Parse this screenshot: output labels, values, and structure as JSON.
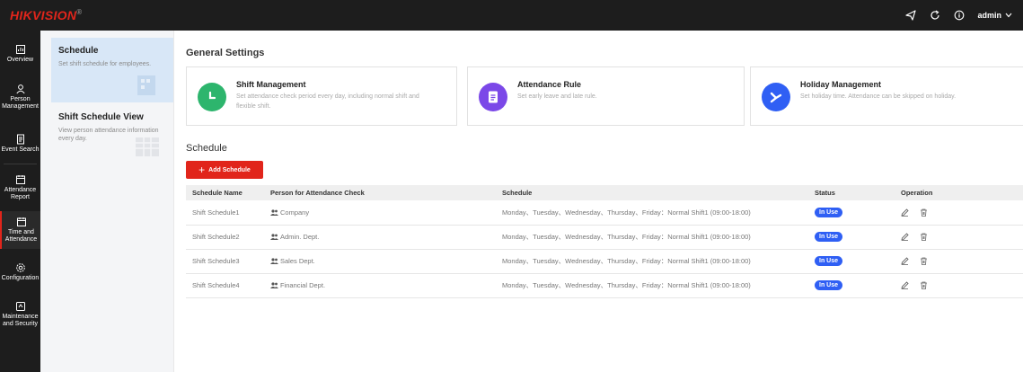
{
  "brand": {
    "name": "HIKVISION",
    "mark": "®"
  },
  "topbar": {
    "icons": [
      "send-icon",
      "refresh-icon",
      "info-icon"
    ],
    "user": "admin"
  },
  "leftnav": {
    "items": [
      {
        "label": "Overview",
        "icon": "dashboard-icon"
      },
      {
        "label": "Person Management",
        "icon": "person-icon"
      },
      {
        "label": "Event Search",
        "icon": "document-icon"
      },
      {
        "label": "Attendance Report",
        "icon": "report-icon"
      },
      {
        "label": "Time and Attendance",
        "icon": "calendar-icon",
        "active": true
      },
      {
        "label": "Configuration",
        "icon": "gear-icon"
      },
      {
        "label": "Maintenance and Security",
        "icon": "shield-icon"
      }
    ]
  },
  "subpanel": {
    "items": [
      {
        "title": "Schedule",
        "desc": "Set shift schedule for employees."
      },
      {
        "title": "Shift Schedule View",
        "desc": "View person attendance information every day."
      }
    ]
  },
  "general": {
    "title": "General Settings",
    "cards": [
      {
        "title": "Shift Management",
        "desc": "Set attendance check period every day, including normal shift and flexible shift.",
        "color": "#2db56d"
      },
      {
        "title": "Attendance Rule",
        "desc": "Set early leave and late rule.",
        "color": "#7b48e8"
      },
      {
        "title": "Holiday Management",
        "desc": "Set holiday time. Attendance can be skipped on holiday.",
        "color": "#2f5ff4"
      }
    ]
  },
  "schedule": {
    "title": "Schedule",
    "add_label": "Add Schedule",
    "columns": [
      "Schedule Name",
      "Person for Attendance Check",
      "Schedule",
      "Status",
      "Operation"
    ],
    "rows": [
      {
        "name": "Shift Schedule1",
        "person": "Company",
        "schedule": "Monday、Tuesday、Wednesday、Thursday、Friday：Normal Shift1  (09:00-18:00)",
        "status": "In Use"
      },
      {
        "name": "Shift Schedule2",
        "person": "Admin. Dept.",
        "schedule": "Monday、Tuesday、Wednesday、Thursday、Friday：Normal Shift1  (09:00-18:00)",
        "status": "In Use"
      },
      {
        "name": "Shift Schedule3",
        "person": "Sales Dept.",
        "schedule": "Monday、Tuesday、Wednesday、Thursday、Friday：Normal Shift1  (09:00-18:00)",
        "status": "In Use"
      },
      {
        "name": "Shift Schedule4",
        "person": "Financial Dept.",
        "schedule": "Monday、Tuesday、Wednesday、Thursday、Friday：Normal Shift1  (09:00-18:00)",
        "status": "In Use"
      }
    ]
  },
  "colors": {
    "accent": "#e1251b",
    "badge": "#2f5ff4",
    "topbar": "#1d1d1d"
  }
}
